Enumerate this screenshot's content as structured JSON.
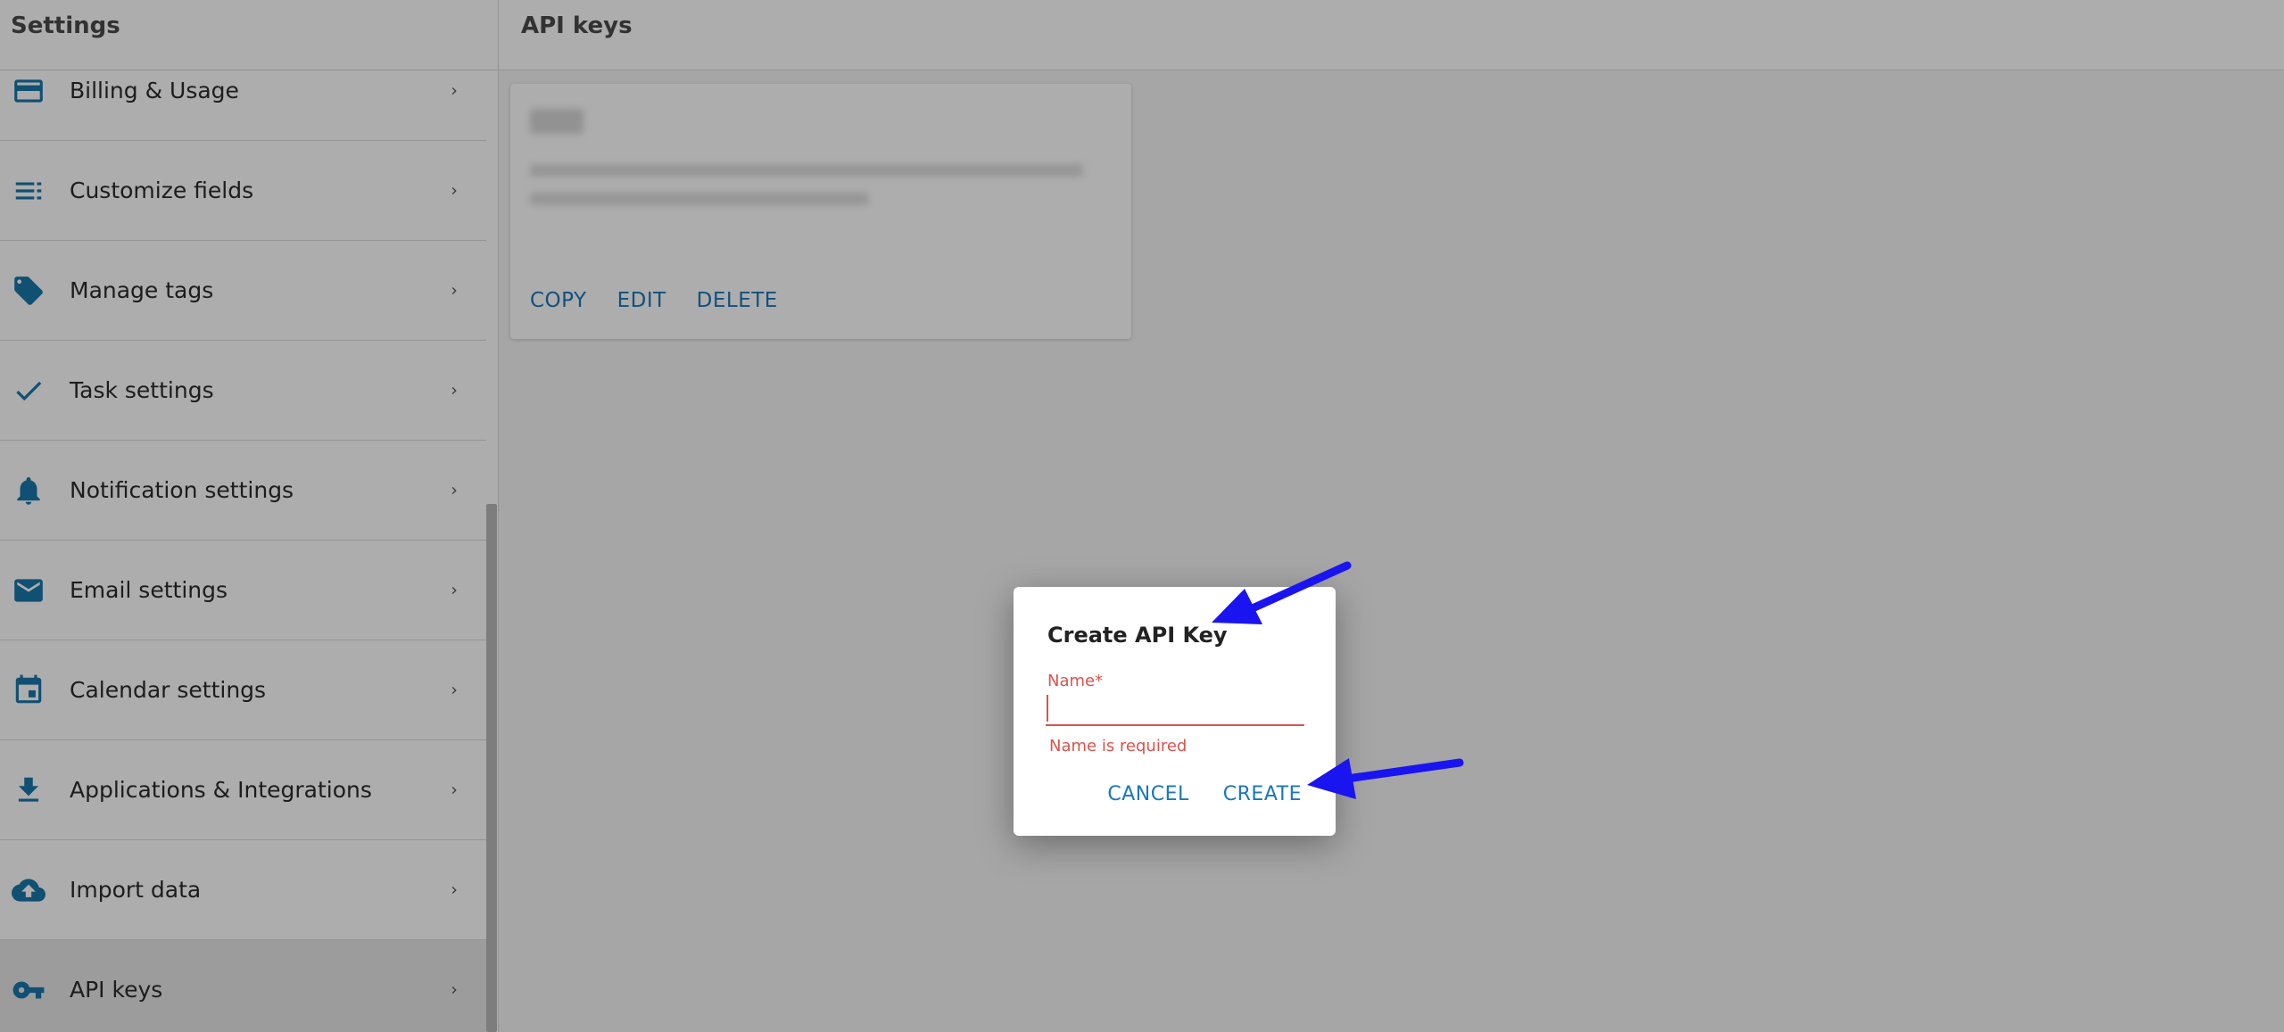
{
  "sidebar": {
    "title": "Settings",
    "items": [
      {
        "label": "Billing & Usage",
        "icon": "credit-card-icon"
      },
      {
        "label": "Customize fields",
        "icon": "list-icon"
      },
      {
        "label": "Manage tags",
        "icon": "tag-icon"
      },
      {
        "label": "Task settings",
        "icon": "check-icon"
      },
      {
        "label": "Notification settings",
        "icon": "bell-icon"
      },
      {
        "label": "Email settings",
        "icon": "mail-icon"
      },
      {
        "label": "Calendar settings",
        "icon": "calendar-icon"
      },
      {
        "label": "Applications & Integrations",
        "icon": "download-icon"
      },
      {
        "label": "Import data",
        "icon": "cloud-upload-icon"
      },
      {
        "label": "API keys",
        "icon": "key-icon",
        "active": true
      }
    ]
  },
  "main": {
    "title": "API keys",
    "card": {
      "actions": {
        "copy": "COPY",
        "edit": "EDIT",
        "delete": "DELETE"
      }
    }
  },
  "dialog": {
    "title": "Create API Key",
    "name_label": "Name*",
    "name_value": "",
    "error": "Name is required",
    "cancel": "CANCEL",
    "create": "CREATE"
  },
  "colors": {
    "accent": "#1a78b8",
    "error": "#d9534f",
    "annotation_arrow": "#1a14f0"
  }
}
